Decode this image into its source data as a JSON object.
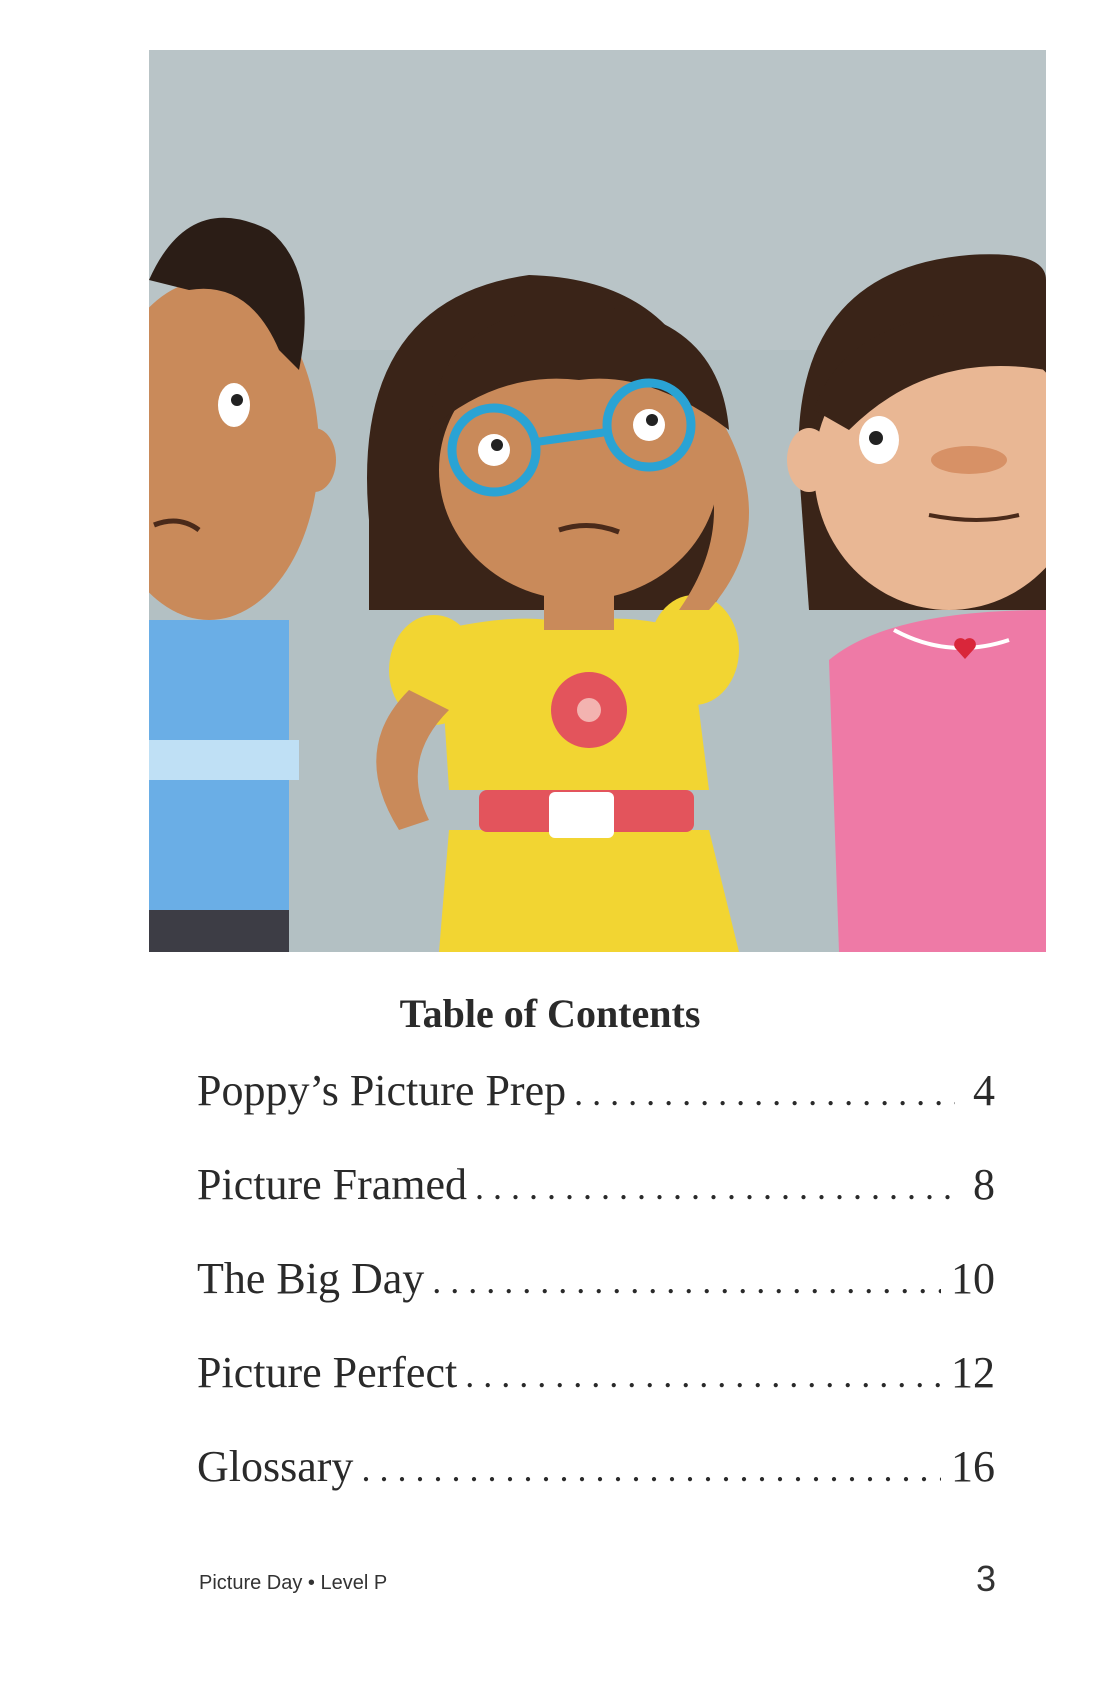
{
  "illustration": {
    "description_icon": "illustration-three-kids",
    "colors": {
      "background": "#b3c0c3",
      "skin": "#c98a5a",
      "hair": "#3a2418",
      "glasses": "#2aa3d4",
      "dress": "#f2d532",
      "belt": "#e3545c",
      "boy_shirt": "#6aaee6",
      "girl_top": "#ee7aa6"
    }
  },
  "toc": {
    "title": "Table of Contents",
    "entries": [
      {
        "label": "Poppy’s Picture Prep",
        "page": "4"
      },
      {
        "label": "Picture Framed",
        "page": "8"
      },
      {
        "label": "The Big Day",
        "page": "10"
      },
      {
        "label": "Picture Perfect",
        "page": "12"
      },
      {
        "label": "Glossary",
        "page": "16"
      }
    ]
  },
  "footer": {
    "book_info": "Picture Day • Level P",
    "page_number": "3"
  }
}
